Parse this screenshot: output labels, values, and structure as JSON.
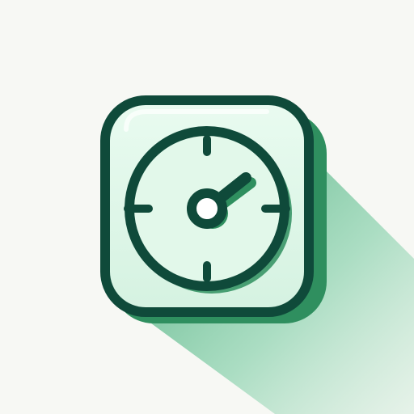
{
  "app_icon": {
    "icon": "gauge-icon",
    "colors": {
      "background": "#f7f8f4",
      "tile_fill": "#dff7e8",
      "outline": "#0f4a3a",
      "accent_shadow": "#2f8f5f",
      "long_shadow": "#6cc79a"
    }
  }
}
